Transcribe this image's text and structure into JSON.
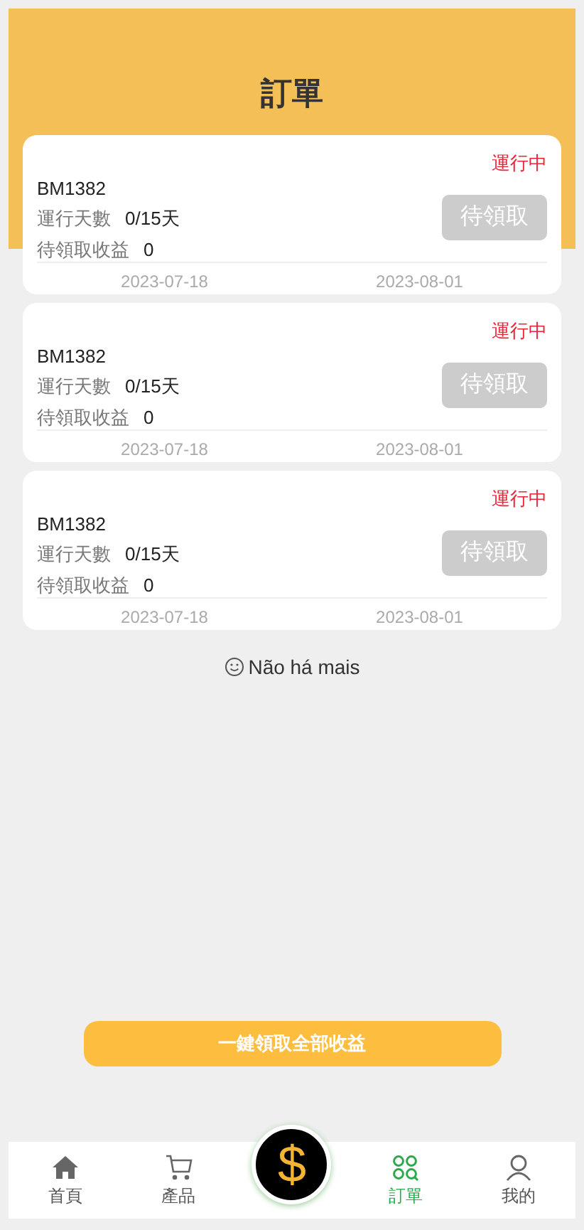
{
  "title": "訂單",
  "orders": [
    {
      "code": "BM1382",
      "status": "運行中",
      "days_label": "運行天數",
      "days": "0/15天",
      "income_label": "待領取收益",
      "income": "0",
      "button": "待領取",
      "disabled": true,
      "start": "2023-07-18",
      "end": "2023-08-01"
    },
    {
      "code": "BM1382",
      "status": "運行中",
      "days_label": "運行天數",
      "days": "0/15天",
      "income_label": "待領取收益",
      "income": "0",
      "button": "待領取",
      "disabled": true,
      "start": "2023-07-18",
      "end": "2023-08-01"
    },
    {
      "code": "BM1382",
      "status": "運行中",
      "days_label": "運行天數",
      "days": "0/15天",
      "income_label": "待領取收益",
      "income": "0",
      "button": "待領取",
      "disabled": true,
      "start": "2023-07-18",
      "end": "2023-08-01"
    }
  ],
  "end_note": "Não há mais",
  "claim_all": "一鍵領取全部收益",
  "tabs": [
    {
      "kind": "home",
      "label": "首頁",
      "selected": false
    },
    {
      "kind": "cart",
      "label": "產品",
      "selected": false
    },
    {
      "kind": "coin",
      "label": "$",
      "selected": false
    },
    {
      "kind": "orders",
      "label": "訂單",
      "selected": true
    },
    {
      "kind": "user",
      "label": "我的",
      "selected": false
    }
  ]
}
